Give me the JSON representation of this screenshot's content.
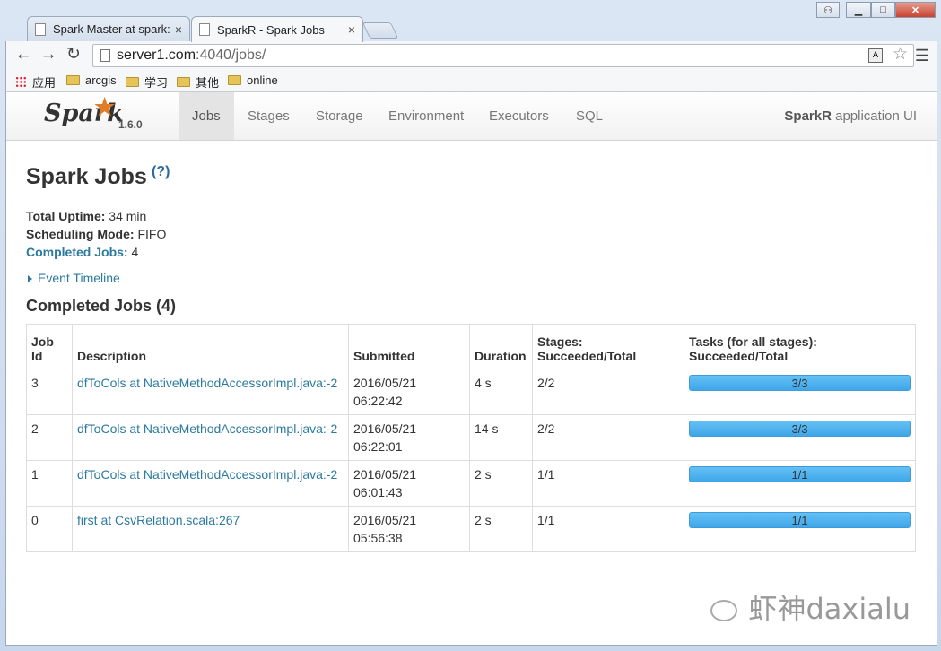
{
  "browser": {
    "tabs": [
      {
        "label": "Spark Master at spark://",
        "active": false
      },
      {
        "label": "SparkR - Spark Jobs",
        "active": true
      }
    ],
    "tab_close": "×",
    "window_buttons": {
      "user": "⚇",
      "minimize": "▁",
      "maximize": "□",
      "close": "✕"
    },
    "nav": {
      "back": "←",
      "forward": "→",
      "reload": "↻"
    },
    "url_host": "server1.com",
    "url_path": ":4040/jobs/",
    "menu_icon": "☰",
    "star_icon": "☆",
    "translate_icon": "A",
    "bookmarks": [
      {
        "label": "应用",
        "icon": "apps-grid-icon"
      },
      {
        "label": "arcgis",
        "icon": "folder-icon"
      },
      {
        "label": "学习",
        "icon": "folder-icon"
      },
      {
        "label": "其他",
        "icon": "folder-icon"
      },
      {
        "label": "online",
        "icon": "folder-icon"
      }
    ]
  },
  "spark": {
    "logo": "Spark",
    "version": "1.6.0",
    "nav": [
      "Jobs",
      "Stages",
      "Storage",
      "Environment",
      "Executors",
      "SQL"
    ],
    "active_nav": "Jobs",
    "app_name_bold": "SparkR",
    "app_name_rest": " application UI"
  },
  "page": {
    "title": "Spark Jobs",
    "help": "(?)",
    "uptime_label": "Total Uptime:",
    "uptime_value": " 34 min",
    "sched_label": "Scheduling Mode:",
    "sched_value": " FIFO",
    "completed_label": "Completed Jobs:",
    "completed_value": " 4",
    "event_timeline": "Event Timeline",
    "section_title": "Completed Jobs (4)"
  },
  "table": {
    "headers": [
      "Job Id",
      "Description",
      "Submitted",
      "Duration",
      "Stages: Succeeded/Total",
      "Tasks (for all stages): Succeeded/Total"
    ],
    "rows": [
      {
        "id": "3",
        "desc": "dfToCols at NativeMethodAccessorImpl.java:-2",
        "submitted_date": "2016/05/21",
        "submitted_time": "06:22:42",
        "duration": "4 s",
        "stages": "2/2",
        "tasks": "3/3",
        "tasks_fraction": 1.0
      },
      {
        "id": "2",
        "desc": "dfToCols at NativeMethodAccessorImpl.java:-2",
        "submitted_date": "2016/05/21",
        "submitted_time": "06:22:01",
        "duration": "14 s",
        "stages": "2/2",
        "tasks": "3/3",
        "tasks_fraction": 1.0
      },
      {
        "id": "1",
        "desc": "dfToCols at NativeMethodAccessorImpl.java:-2",
        "submitted_date": "2016/05/21",
        "submitted_time": "06:01:43",
        "duration": "2 s",
        "stages": "1/1",
        "tasks": "1/1",
        "tasks_fraction": 1.0
      },
      {
        "id": "0",
        "desc": "first at CsvRelation.scala:267",
        "submitted_date": "2016/05/21",
        "submitted_time": "05:56:38",
        "duration": "2 s",
        "stages": "1/1",
        "tasks": "1/1",
        "tasks_fraction": 1.0
      }
    ]
  },
  "watermark": "虾神daxialu"
}
